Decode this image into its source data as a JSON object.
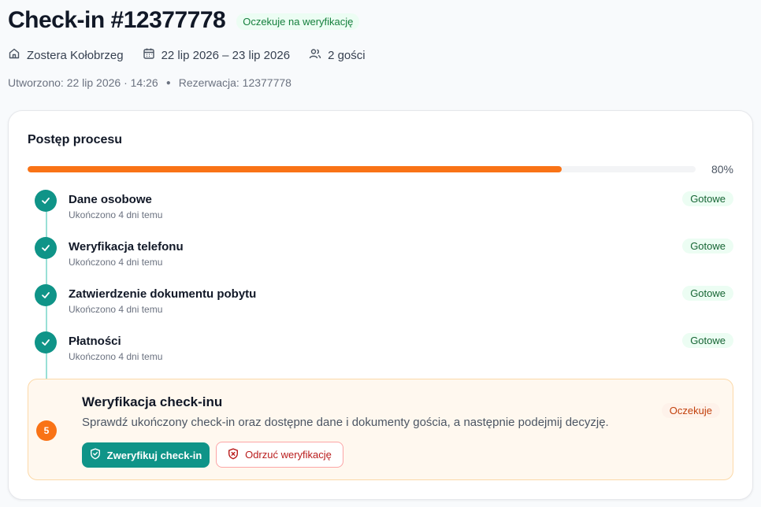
{
  "header": {
    "title": "Check-in #12377778",
    "status_badge": "Oczekuje na weryfikację",
    "property": "Zostera Kołobrzeg",
    "dates": "22 lip 2026 – 23 lip 2026",
    "guests": "2 gości",
    "created": "Utworzono: 22 lip 2026 · 14:26",
    "reservation": "Rezerwacja: 12377778"
  },
  "progress": {
    "title": "Postęp procesu",
    "percent_label": "80%",
    "percent_value": 80
  },
  "steps": [
    {
      "title": "Dane osobowe",
      "sub": "Ukończono 4 dni temu",
      "badge": "Gotowe"
    },
    {
      "title": "Weryfikacja telefonu",
      "sub": "Ukończono 4 dni temu",
      "badge": "Gotowe"
    },
    {
      "title": "Zatwierdzenie dokumentu pobytu",
      "sub": "Ukończono 4 dni temu",
      "badge": "Gotowe"
    },
    {
      "title": "Płatności",
      "sub": "Ukończono 4 dni temu",
      "badge": "Gotowe"
    }
  ],
  "active_step": {
    "number": "5",
    "title": "Weryfikacja check-inu",
    "description": "Sprawdź ukończony check-in oraz dostępne dane i dokumenty gościa, a następnie podejmij decyzję.",
    "badge": "Oczekuje",
    "verify_label": "Zweryfikuj check-in",
    "reject_label": "Odrzuć weryfikację"
  },
  "colors": {
    "accent_teal": "#0f9488",
    "progress_orange": "#f97316",
    "done_green": "#166534",
    "reject_red": "#b91c1c"
  },
  "icons": [
    "home-icon",
    "calendar-icon",
    "users-icon",
    "check-icon",
    "shield-check-icon",
    "shield-x-icon"
  ]
}
